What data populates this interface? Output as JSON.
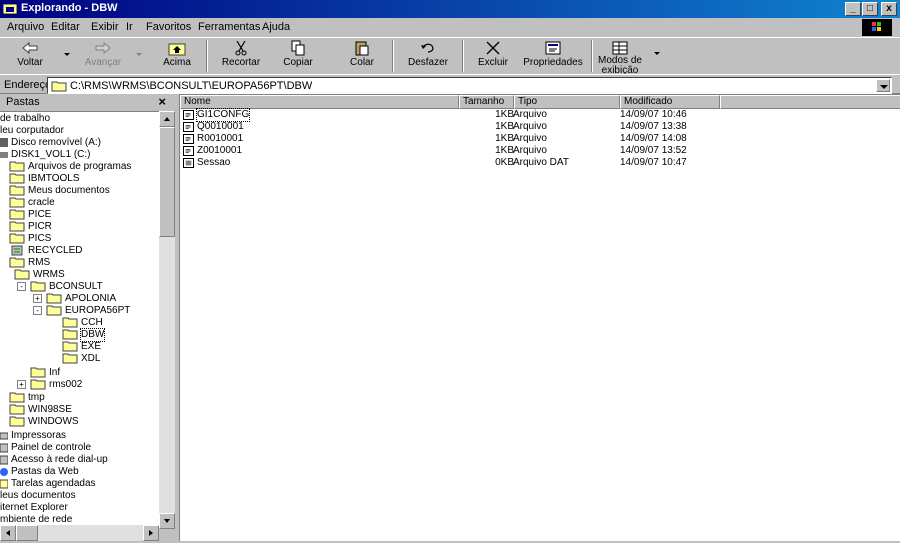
{
  "window": {
    "title": "Explorando - DBW",
    "minimize": "_",
    "maximize": "□",
    "close": "x"
  },
  "menu": [
    {
      "label": "Arquivo"
    },
    {
      "label": "Editar"
    },
    {
      "label": "Exibir"
    },
    {
      "label": "Ir"
    },
    {
      "label": "Favoritos"
    },
    {
      "label": "Ferramentas"
    },
    {
      "label": "Ajuda"
    }
  ],
  "toolbar": {
    "back": "Voltar",
    "forward": "Avançar",
    "up": "Acima",
    "cut": "Recortar",
    "copy": "Copiar",
    "paste": "Colar",
    "undo": "Desfazer",
    "delete": "Excluir",
    "properties": "Propriedades",
    "views_line1": "Modos de",
    "views_line2": "exibição"
  },
  "address": {
    "label": "Endereço",
    "value": "C:\\RMS\\WRMS\\BCONSULT\\EUROPA56PT\\DBW"
  },
  "left_pane": {
    "title": "Pastas",
    "close": "×",
    "tree": [
      {
        "label": "de trabalho"
      },
      {
        "label": "leu corputador"
      },
      {
        "label": "Disco removível (A:)"
      },
      {
        "label": "DISK1_VOL1 (C:)"
      },
      {
        "label": "Arquivos de programas"
      },
      {
        "label": "IBMTOOLS"
      },
      {
        "label": "Meus documentos"
      },
      {
        "label": "cracle"
      },
      {
        "label": "PICE"
      },
      {
        "label": "PICR"
      },
      {
        "label": "PICS"
      },
      {
        "label": "RECYCLED"
      },
      {
        "label": "RMS"
      },
      {
        "label": "WRMS"
      },
      {
        "label": "BCONSULT"
      },
      {
        "label": "APOLONIA"
      },
      {
        "label": "EUROPA56PT"
      },
      {
        "label": "CCH"
      },
      {
        "label": "DBW"
      },
      {
        "label": "EXE"
      },
      {
        "label": "XDL"
      },
      {
        "label": "Inf"
      },
      {
        "label": "rms002"
      },
      {
        "label": "tmp"
      },
      {
        "label": "WIN98SE"
      },
      {
        "label": "WINDOWS"
      },
      {
        "label": "Impressoras"
      },
      {
        "label": "Painel de controle"
      },
      {
        "label": "Acesso à rede dial-up"
      },
      {
        "label": "Pastas da Web"
      },
      {
        "label": "Tarelas agendadas"
      },
      {
        "label": "leus documentos"
      },
      {
        "label": "iternet Explorer"
      },
      {
        "label": "mbiente de rede"
      }
    ]
  },
  "file_list": {
    "columns": [
      "Nome",
      "Tamanho",
      "Tipo",
      "Modificado"
    ],
    "rows": [
      {
        "name": "GI1CONFG",
        "size": "1KB",
        "type": "Arquivo",
        "modified": "14/09/07 10:46"
      },
      {
        "name": "Q0010001",
        "size": "1KB",
        "type": "Arquivo",
        "modified": "14/09/07 13:38"
      },
      {
        "name": "R0010001",
        "size": "1KB",
        "type": "Arquivo",
        "modified": "14/09/07 14:08"
      },
      {
        "name": "Z0010001",
        "size": "1KB",
        "type": "Arquivo",
        "modified": "14/09/07 13:52"
      },
      {
        "name": "Sessao",
        "size": "0KB",
        "type": "Arquivo DAT",
        "modified": "14/09/07 10:47"
      }
    ]
  },
  "icons": {
    "app": "explorer-icon",
    "folder": "folder-icon",
    "document": "document-icon"
  },
  "colors": {
    "title_start": "#000080",
    "title_end": "#1084d0",
    "face": "#c0c0c0",
    "folder_yellow": "#ffff99"
  }
}
